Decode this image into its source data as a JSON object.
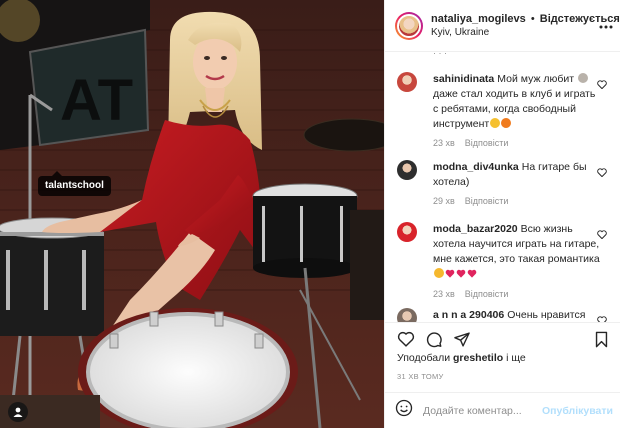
{
  "photo": {
    "tag_label": "talantschool"
  },
  "header": {
    "username": "nataliya_mogilevs",
    "separator": "•",
    "follow_status": "Відстежується",
    "location": "Kyiv, Ukraine",
    "more_icon": "more-horizontal-icon"
  },
  "comments": [
    {
      "username": "sahinidinata",
      "text": "Мой муж любит ",
      "text2": " даже стал ходить в клуб и играть с ребятами, когда свободный инструмент",
      "time": "23 хв",
      "reply": "Відповісти",
      "avatar_color": "#c7473d"
    },
    {
      "username": "modna_div4unka",
      "text": "На гитаре бы хотела)",
      "time": "29 хв",
      "reply": "Відповісти",
      "avatar_color": "#3d3d3d"
    },
    {
      "username": "moda_bazar2020",
      "text": "Всю жизнь хотела научится играть на гитаре, мне кажется, это такая романтика",
      "time": "23 хв",
      "reply": "Відповісти",
      "avatar_color": "#d8232a"
    },
    {
      "username": "a n n a 290406",
      "text": "Очень нравится",
      "avatar_color": "#7a6a60"
    }
  ],
  "likes": {
    "prefix": "Уподобали",
    "user": "greshetilo",
    "suffix": "і ще"
  },
  "timestamp": "31 ХВ ТОМУ",
  "composer": {
    "placeholder": "Додайте коментар...",
    "publish_label": "Опублікувати"
  },
  "colors": {
    "accent_disabled": "#b2dffc",
    "heart_red": "#e0245e",
    "dress": "#b5161c"
  }
}
